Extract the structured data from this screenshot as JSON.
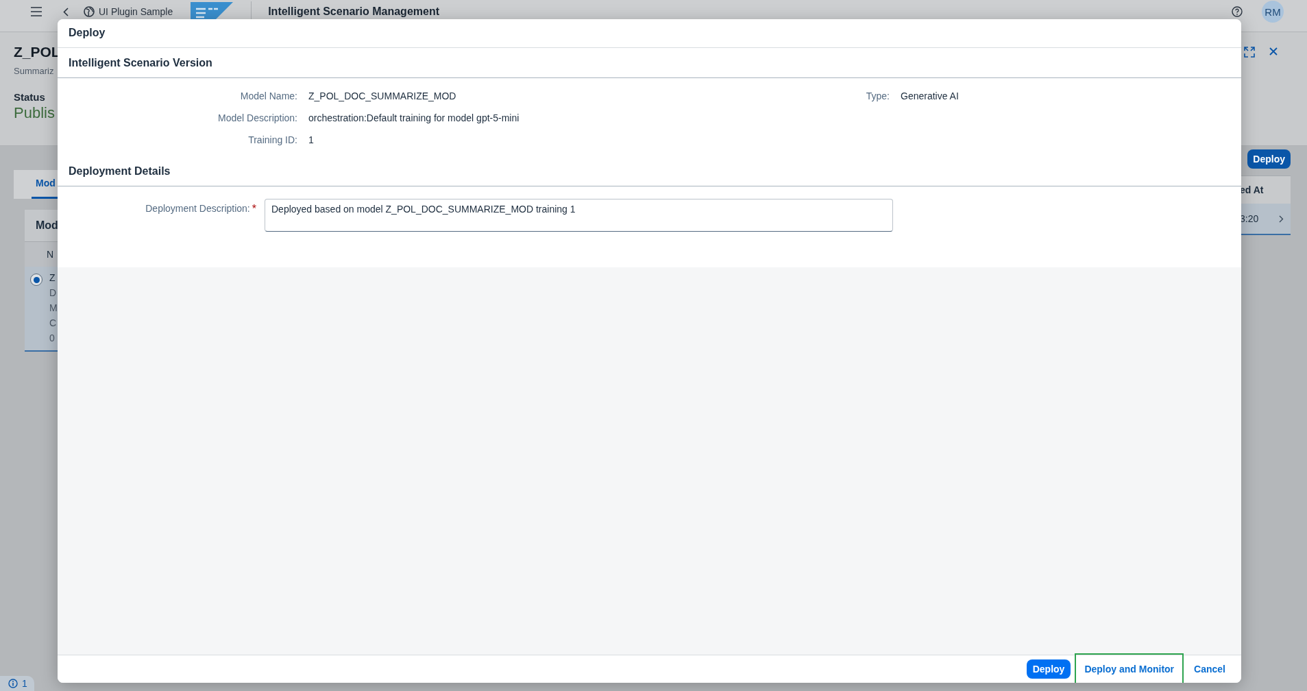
{
  "shell_bar": {
    "app_title": "UI Plugin Sample",
    "title": "Intelligent Scenario Management",
    "avatar": "RM"
  },
  "background_page": {
    "object_title": "Z_POL",
    "object_subtitle": "Summariz",
    "status_label": "Status",
    "status_value": "Publis",
    "tabs": [
      {
        "label": "Mod",
        "selected": true
      }
    ],
    "panel_title": "Mod",
    "toolbar_button": "Deploy",
    "columns": [
      "N",
      "ed At"
    ],
    "rows": [
      {
        "selected": true,
        "column_1": "Z",
        "lines": [
          "D",
          "M",
          "C",
          "0"
        ],
        "time": "3:20"
      }
    ]
  },
  "dialog": {
    "title": "Deploy",
    "sections": [
      {
        "title": "Intelligent Scenario Version",
        "fields": [
          {
            "label": "Model Name:",
            "value": "Z_POL_DOC_SUMMARIZE_MOD"
          },
          {
            "label": "Model Description:",
            "value": "orchestration:Default training for model gpt-5-mini"
          },
          {
            "label": "Training ID:",
            "value": "1"
          }
        ],
        "side_fields": [
          {
            "label": "Type:",
            "value": "Generative AI"
          }
        ]
      },
      {
        "title": "Deployment Details",
        "inputs": [
          {
            "label": "Deployment Description:",
            "required": true,
            "required_mark": "*",
            "value": "Deployed based on model Z_POL_DOC_SUMMARIZE_MOD training 1"
          }
        ]
      }
    ],
    "buttons": [
      {
        "label": "Deploy",
        "kind": "emphasized",
        "highlighted": false
      },
      {
        "label": "Deploy and Monitor",
        "kind": "transparent",
        "highlighted": true
      },
      {
        "label": "Cancel",
        "kind": "transparent",
        "highlighted": false
      }
    ]
  },
  "message_badge": "1"
}
